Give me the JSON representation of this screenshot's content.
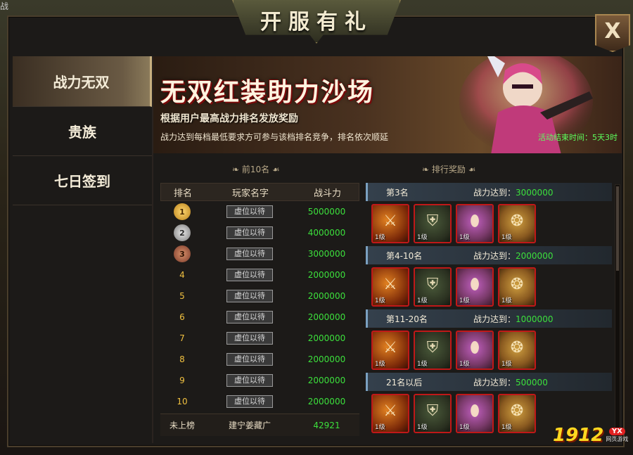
{
  "header": {
    "title": "开服有礼",
    "corner_label": "战"
  },
  "close_button": {
    "label": "X"
  },
  "sidebar": {
    "items": [
      {
        "label": "战力无双",
        "active": true
      },
      {
        "label": "贵族",
        "active": false
      },
      {
        "label": "七日签到",
        "active": false
      }
    ]
  },
  "banner": {
    "title": "无双红装助力沙场",
    "subtitle": "根据用户最高战力排名发放奖励",
    "description": "战力达到每档最低要求方可参与该档排名竞争，排名依次顺延",
    "time_label": "活动结束时间：5天3时"
  },
  "ranking": {
    "section_title": "前10名",
    "columns": [
      "排名",
      "玩家名字",
      "战斗力"
    ],
    "rows": [
      {
        "rank": "1",
        "name": "虚位以待",
        "power": "5000000",
        "medal": "gold"
      },
      {
        "rank": "2",
        "name": "虚位以待",
        "power": "4000000",
        "medal": "silver"
      },
      {
        "rank": "3",
        "name": "虚位以待",
        "power": "3000000",
        "medal": "bronze"
      },
      {
        "rank": "4",
        "name": "虚位以待",
        "power": "2000000"
      },
      {
        "rank": "5",
        "name": "虚位以待",
        "power": "2000000"
      },
      {
        "rank": "6",
        "name": "虚位以待",
        "power": "2000000"
      },
      {
        "rank": "7",
        "name": "虚位以待",
        "power": "2000000"
      },
      {
        "rank": "8",
        "name": "虚位以待",
        "power": "2000000"
      },
      {
        "rank": "9",
        "name": "虚位以待",
        "power": "2000000"
      },
      {
        "rank": "10",
        "name": "虚位以待",
        "power": "2000000"
      }
    ],
    "me": {
      "rank": "未上榜",
      "name": "建宁姜藏广",
      "power": "42921"
    }
  },
  "rewards": {
    "section_title": "排行奖励",
    "req_prefix": "战力达到：",
    "item_level": "1级",
    "tiers": [
      {
        "name": "第3名",
        "requirement": "3000000"
      },
      {
        "name": "第4-10名",
        "requirement": "2000000"
      },
      {
        "name": "第11-20名",
        "requirement": "1000000"
      },
      {
        "name": "21名以后",
        "requirement": "500000"
      }
    ],
    "items": [
      {
        "kind": "weapon",
        "icon": "sword-icon"
      },
      {
        "kind": "armor",
        "icon": "armor-icon"
      },
      {
        "kind": "boots",
        "icon": "boots-icon"
      },
      {
        "kind": "neck",
        "icon": "necklace-icon"
      }
    ]
  },
  "logo": {
    "number": "1912",
    "badge": "YX",
    "caption": "网页游戏"
  },
  "colors": {
    "green_value": "#3ce03c",
    "gold_rank": "#f0c040",
    "item_border": "#c01818"
  }
}
